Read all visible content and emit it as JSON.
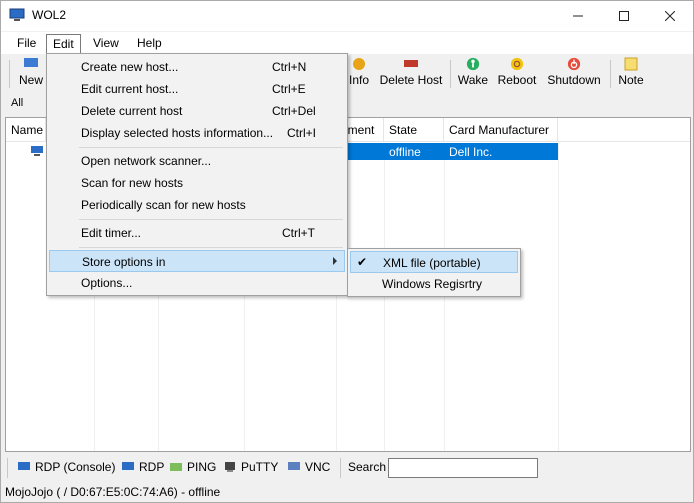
{
  "window": {
    "title": "WOL2"
  },
  "menubar": {
    "file": "File",
    "edit": "Edit",
    "view": "View",
    "help": "Help"
  },
  "toolbar": {
    "new": "New",
    "info": "Info",
    "delete_host": "Delete Host",
    "wake": "Wake",
    "reboot": "Reboot",
    "shutdown": "Shutdown",
    "note": "Note"
  },
  "filter": {
    "tab": "All"
  },
  "list": {
    "columns": [
      "Name",
      "",
      "",
      "",
      "",
      "nment",
      "State",
      "Card Manufacturer"
    ],
    "rows": [
      {
        "name": "",
        "state": "offline",
        "manufacturer": "Dell Inc."
      }
    ]
  },
  "edit_menu": {
    "items": [
      {
        "label": "Create new host...",
        "shortcut": "Ctrl+N"
      },
      {
        "label": "Edit current host...",
        "shortcut": "Ctrl+E"
      },
      {
        "label": "Delete current host",
        "shortcut": "Ctrl+Del"
      },
      {
        "label": "Display selected hosts information...",
        "shortcut": "Ctrl+I"
      },
      {
        "label": "Open network scanner...",
        "shortcut": ""
      },
      {
        "label": "Scan for new hosts",
        "shortcut": ""
      },
      {
        "label": "Periodically scan for new hosts",
        "shortcut": ""
      },
      {
        "label": "Edit timer...",
        "shortcut": "Ctrl+T"
      },
      {
        "label": "Store options in",
        "shortcut": ""
      },
      {
        "label": "Options...",
        "shortcut": ""
      }
    ]
  },
  "store_submenu": {
    "items": [
      {
        "label": "XML file (portable)",
        "checked": true
      },
      {
        "label": "Windows Regisrtry",
        "checked": false
      }
    ]
  },
  "quickbar": {
    "rdp_console": "RDP (Console)",
    "rdp": "RDP",
    "ping": "PING",
    "putty": "PuTTY",
    "vnc": "VNC",
    "search_label": "Search",
    "search_value": ""
  },
  "status": {
    "text": "MojoJojo ( / D0:67:E5:0C:74:A6) - offline"
  },
  "colors": {
    "selection": "#0078d7",
    "menu_hover": "#cce4f7",
    "menu_bg": "#f2f2f2"
  }
}
